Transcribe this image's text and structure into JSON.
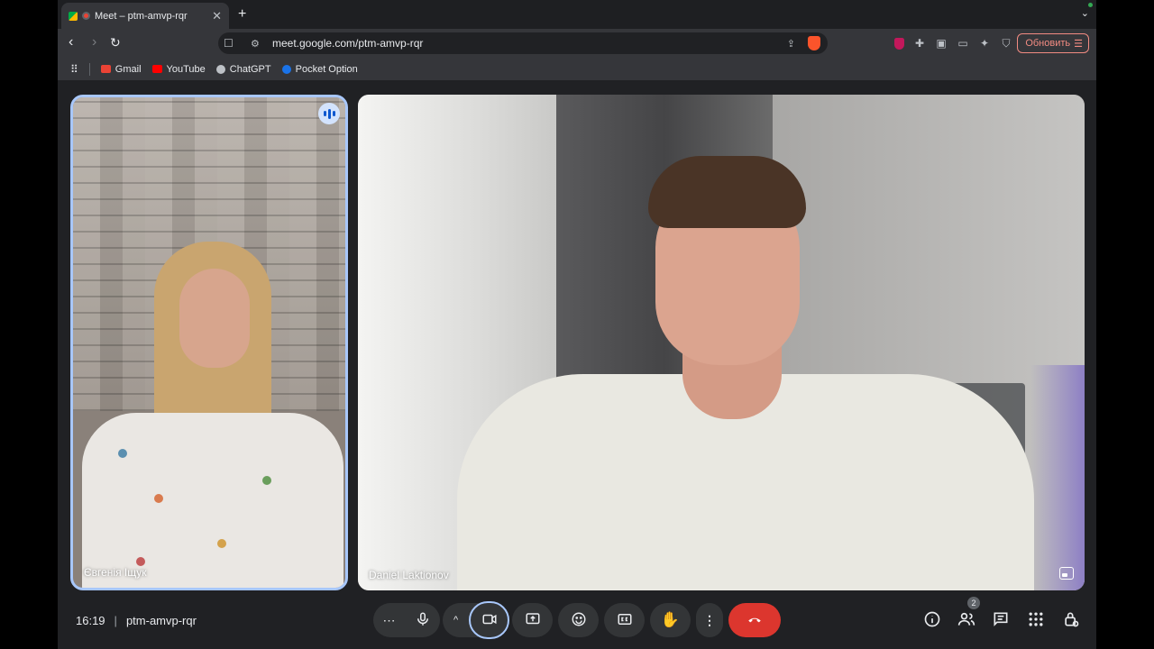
{
  "browser": {
    "tab_title": "Meet – ptm-amvp-rqr",
    "url": "meet.google.com/ptm-amvp-rqr",
    "update_label": "Обновить",
    "bookmarks": [
      {
        "label": "Gmail",
        "color": "#ea4335"
      },
      {
        "label": "YouTube",
        "color": "#ff0000"
      },
      {
        "label": "ChatGPT",
        "color": "#bdc1c6"
      },
      {
        "label": "Pocket Option",
        "color": "#1a73e8"
      }
    ]
  },
  "meeting": {
    "time": "16:19",
    "code": "ptm-amvp-rqr",
    "participant_count": "2",
    "participants": [
      {
        "name": "Євгенія Іщук"
      },
      {
        "name": "Daniel Laktionov"
      }
    ]
  },
  "colors": {
    "accent": "#a8c7fa",
    "end_call": "#dc362e",
    "control_bg": "#333537"
  }
}
